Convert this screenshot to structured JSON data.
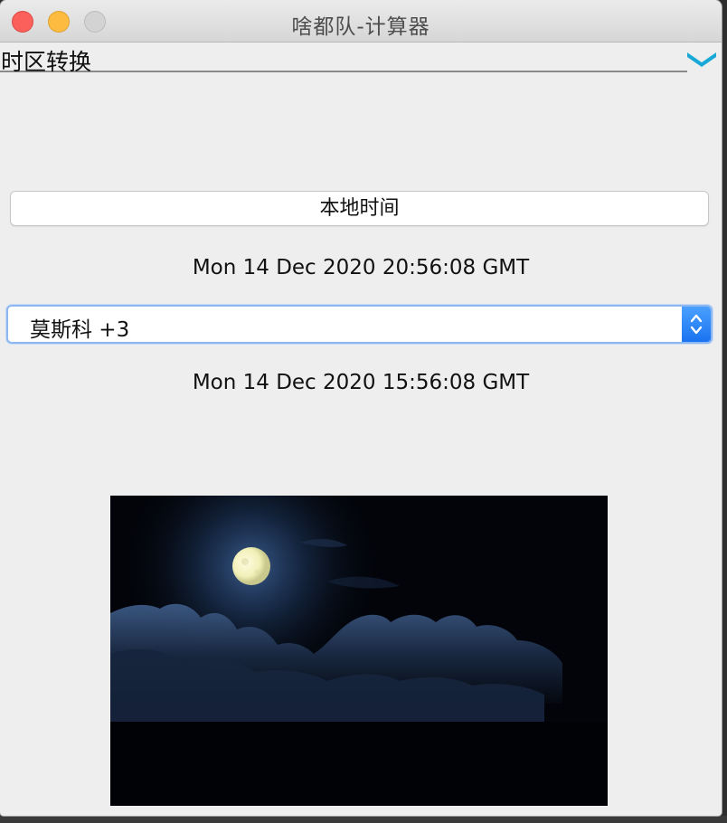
{
  "window": {
    "title": "啥都队-计算器"
  },
  "menu": {
    "selected": "时区转换",
    "chevron_icon": "chevron-down-icon",
    "chevron_color": "#1aa9d6"
  },
  "local_time_button": {
    "label": "本地时间"
  },
  "local_time": {
    "text": "Mon 14 Dec 2020 20:56:08 GMT"
  },
  "timezone_select": {
    "value": "莫斯科 +3",
    "icon": "up-down-stepper-icon",
    "accent": "#1a73f0"
  },
  "converted_time": {
    "text": "Mon 14 Dec 2020 15:56:08 GMT"
  },
  "image": {
    "subject": "moon-over-clouds-image"
  }
}
